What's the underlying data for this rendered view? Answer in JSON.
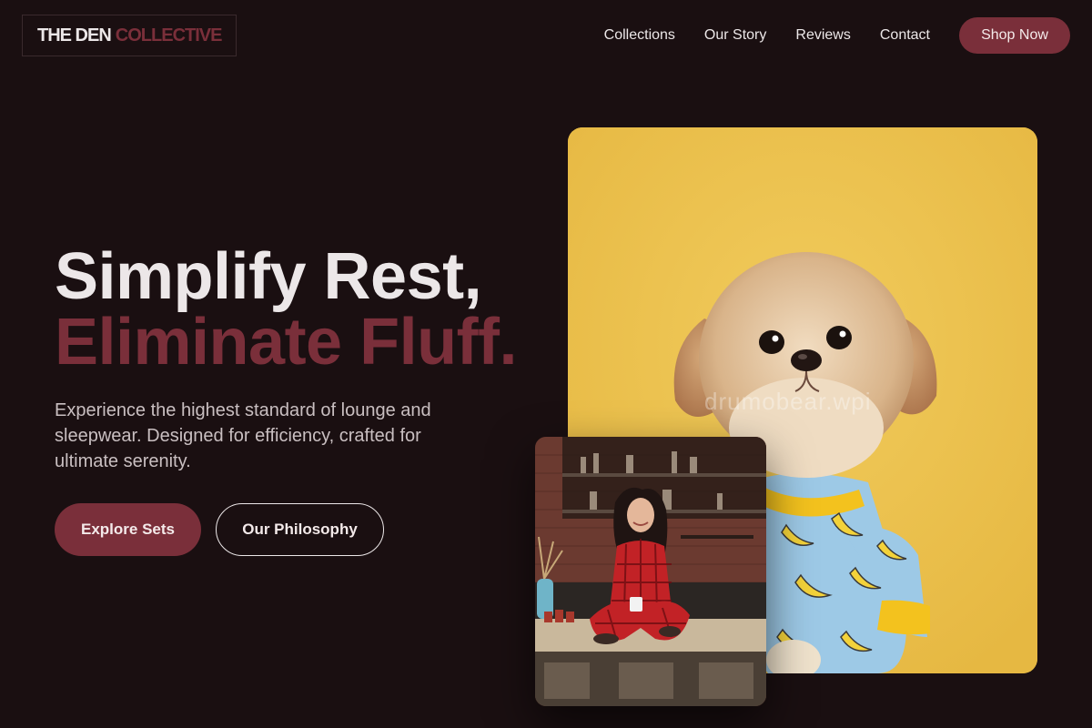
{
  "brand": {
    "part1": "THE DEN",
    "part2": "COLLECTIVE"
  },
  "nav": {
    "items": [
      "Collections",
      "Our Story",
      "Reviews",
      "Contact"
    ],
    "cta": "Shop Now"
  },
  "hero": {
    "title_line1": "Simplify Rest,",
    "title_line2": "Eliminate Fluff.",
    "description": "Experience the highest standard of lounge and sleepwear. Designed for efficiency, crafted for ultimate serenity.",
    "primary_button": "Explore Sets",
    "secondary_button": "Our Philosophy"
  },
  "images": {
    "main_watermark": "drumobear.wpi"
  },
  "colors": {
    "background": "#1a0f11",
    "accent": "#7a2f3a",
    "text": "#ece7e8",
    "dog_backdrop": "#ecc24e"
  }
}
